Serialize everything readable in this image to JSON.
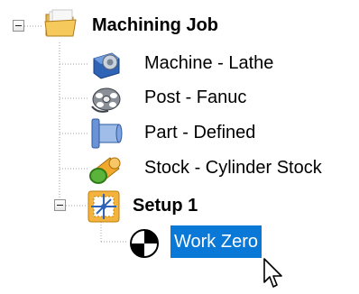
{
  "tree": {
    "root": {
      "label": "Machining Job",
      "expanded": true,
      "icon": "folder-icon",
      "children": [
        {
          "label": "Machine - Lathe",
          "icon": "machine-icon"
        },
        {
          "label": "Post - Fanuc",
          "icon": "post-reel-icon"
        },
        {
          "label": "Part - Defined",
          "icon": "part-icon"
        },
        {
          "label": "Stock - Cylinder Stock",
          "icon": "stock-cylinder-icon"
        }
      ]
    },
    "setup": {
      "label": "Setup 1",
      "expanded": true,
      "icon": "setup-icon",
      "children": [
        {
          "label": "Work Zero",
          "icon": "work-zero-icon",
          "selected": true
        }
      ]
    }
  },
  "colors": {
    "selection": "#0a78d7",
    "selection_text": "#ffffff",
    "tree_line": "#a0a0a0"
  }
}
